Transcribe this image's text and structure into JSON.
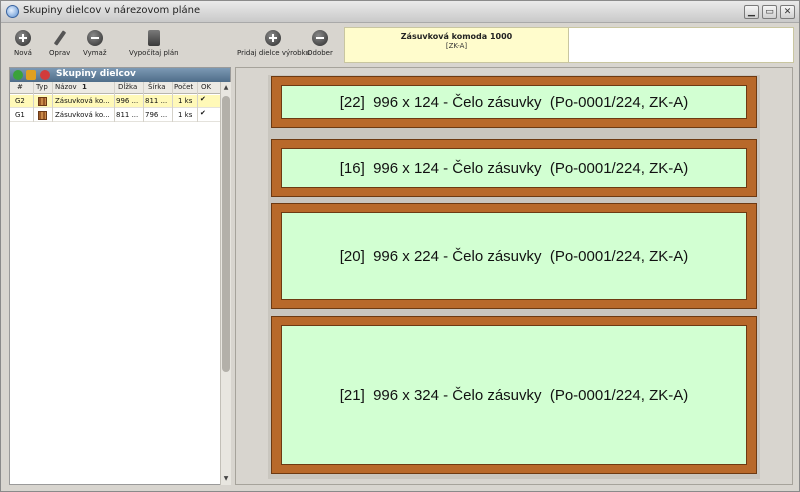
{
  "window": {
    "title": "Skupiny dielcov v nárezovom pláne",
    "controls": {
      "min": "▁",
      "max": "▭",
      "close": "✕"
    }
  },
  "toolbar": {
    "new_label": "Nová",
    "edit_label": "Oprav",
    "delete_label": "Vymaž",
    "compute_label": "Vypočítaj plán",
    "add_parts_label": "Pridaj dielce výrobku",
    "remove_label": "Odober"
  },
  "product": {
    "name": "Zásuvková komoda 1000",
    "code": "[ZK-A]"
  },
  "panel": {
    "title": "Skupiny dielcov",
    "columns": [
      "#",
      "Typ",
      "Názov",
      "Dĺžka",
      "Šírka",
      "Počet",
      "OK"
    ],
    "sort_indicator": "1",
    "rows": [
      {
        "id": "G2",
        "name": "Zásuvková ko...",
        "length": "996 ...",
        "width": "811 ...",
        "count": "1 ks",
        "ok": "✔"
      },
      {
        "id": "G1",
        "name": "Zásuvková ko...",
        "length": "811 ...",
        "width": "796 ...",
        "count": "1 ks",
        "ok": "✔"
      }
    ],
    "scroll": {
      "up": "▲",
      "down": "▼"
    }
  },
  "parts": [
    {
      "label": "[22]  996 x 124 - Čelo zásuvky  (Po-0001/224, ZK-A)"
    },
    {
      "label": "[16]  996 x 124 - Čelo zásuvky  (Po-0001/224, ZK-A)"
    },
    {
      "label": "[20]  996 x 224 - Čelo zásuvky  (Po-0001/224, ZK-A)"
    },
    {
      "label": "[21]  996 x 324 - Čelo zásuvky  (Po-0001/224, ZK-A)"
    }
  ],
  "colors": {
    "part_edge": "#b8692a",
    "part_face": "#d2ffd2",
    "selected_row": "#fff9b8",
    "product_box": "#fffccc"
  }
}
